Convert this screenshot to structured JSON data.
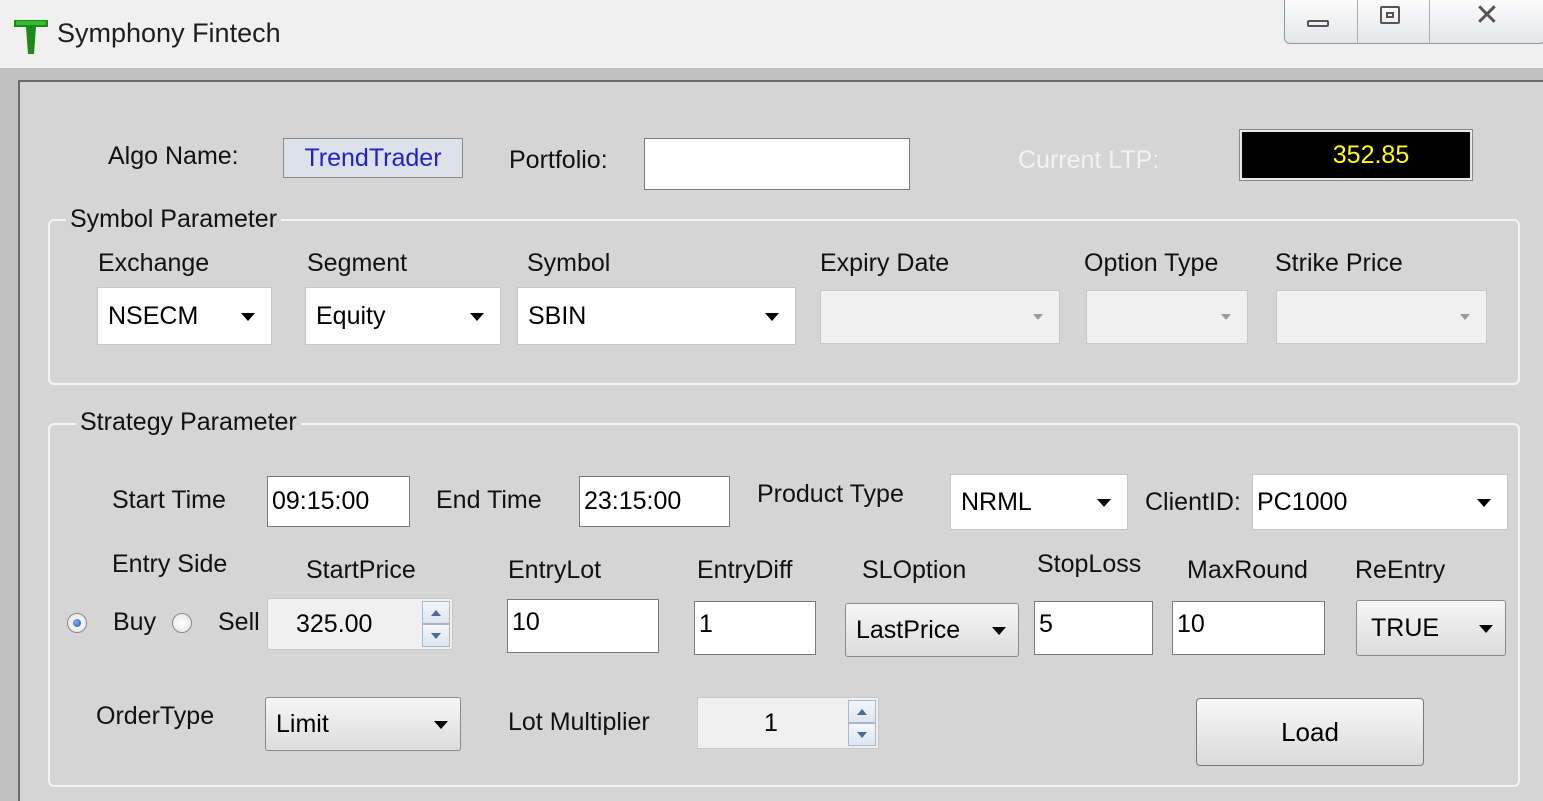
{
  "window": {
    "title": "Symphony Fintech",
    "buttons": [
      "minimize-icon",
      "restore-icon",
      "close-icon"
    ]
  },
  "header": {
    "algo_name_label": "Algo Name:",
    "algo_name_value": "TrendTrader",
    "portfolio_label": "Portfolio:",
    "portfolio_value": "",
    "ltp_label": "Current LTP:",
    "ltp_value": "352.85"
  },
  "symbol_group": {
    "title": "Symbol Parameter",
    "exchange_label": "Exchange",
    "exchange_value": "NSECM",
    "segment_label": "Segment",
    "segment_value": "Equity",
    "symbol_label": "Symbol",
    "symbol_value": "SBIN",
    "expiry_label": "Expiry Date",
    "expiry_value": "",
    "option_type_label": "Option Type",
    "option_type_value": "",
    "strike_label": "Strike Price",
    "strike_value": ""
  },
  "strategy_group": {
    "title": "Strategy Parameter",
    "start_time_label": "Start Time",
    "start_time_value": "09:15:00",
    "end_time_label": "End Time",
    "end_time_value": "23:15:00",
    "product_type_label": "Product Type",
    "product_type_value": "NRML",
    "client_id_label": "ClientID:",
    "client_id_value": "PC1000",
    "entry_side_label": "Entry Side",
    "buy_label": "Buy",
    "sell_label": "Sell",
    "entry_side_selected": "Buy",
    "start_price_label": "StartPrice",
    "start_price_value": "325.00",
    "entry_lot_label": "EntryLot",
    "entry_lot_value": "10",
    "entry_diff_label": "EntryDiff",
    "entry_diff_value": "1",
    "sl_option_label": "SLOption",
    "sl_option_value": "LastPrice",
    "stop_loss_label": "StopLoss",
    "stop_loss_value": "5",
    "max_round_label": "MaxRound",
    "max_round_value": "10",
    "re_entry_label": "ReEntry",
    "re_entry_value": "TRUE",
    "order_type_label": "OrderType",
    "order_type_value": "Limit",
    "lot_multiplier_label": "Lot Multiplier",
    "lot_multiplier_value": "1",
    "load_label": "Load"
  },
  "colors": {
    "client_bg": "#d5d5d5",
    "ltp_text": "#ffff00",
    "ltp_bg": "#000000",
    "algo_text": "#2222cc"
  }
}
